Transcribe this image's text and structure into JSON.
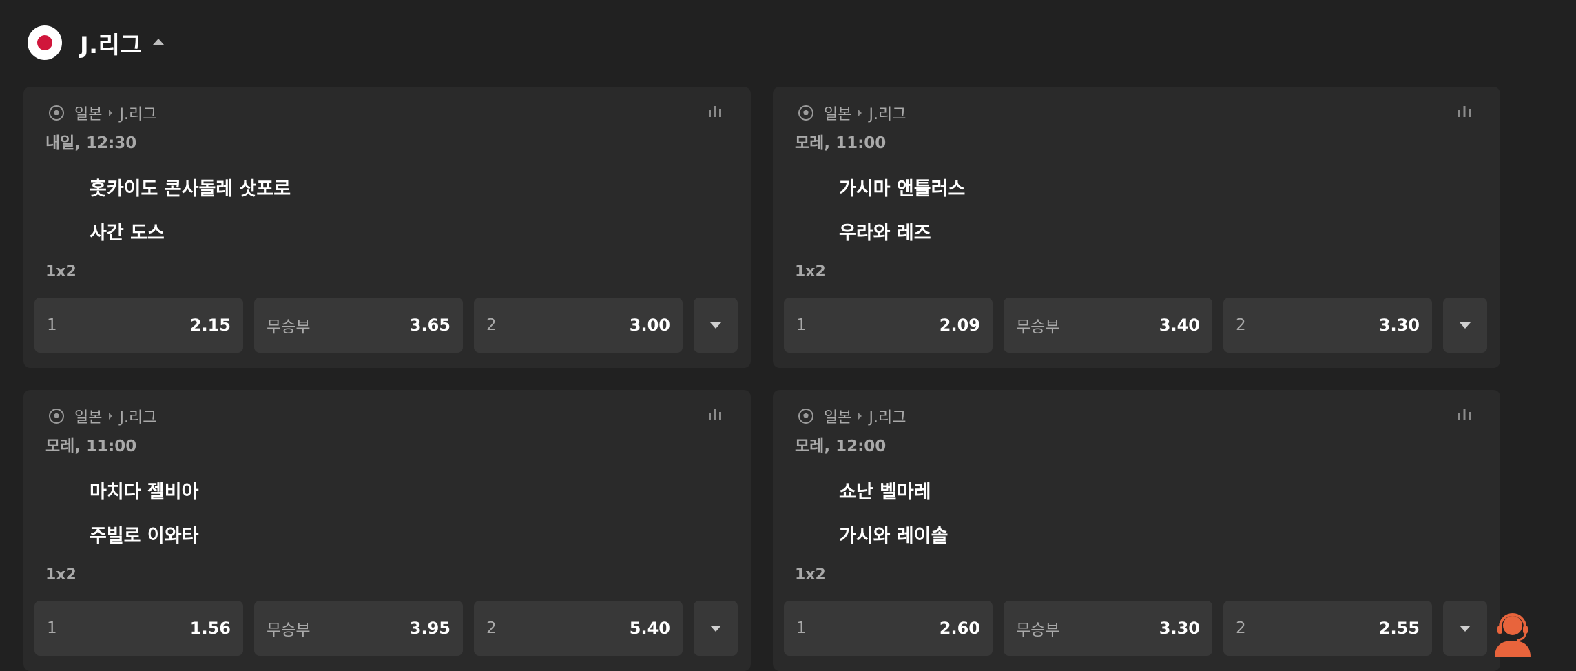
{
  "league": {
    "title": "J.리그"
  },
  "matches": [
    {
      "country": "일본",
      "league": "J.리그",
      "time": "내일, 12:30",
      "home": "홋카이도 콘사돌레 삿포로",
      "away": "사간 도스",
      "market": "1x2",
      "odds": [
        {
          "label": "1",
          "value": "2.15"
        },
        {
          "label": "무승부",
          "value": "3.65"
        },
        {
          "label": "2",
          "value": "3.00"
        }
      ]
    },
    {
      "country": "일본",
      "league": "J.리그",
      "time": "모레, 11:00",
      "home": "가시마 앤틀러스",
      "away": "우라와 레즈",
      "market": "1x2",
      "odds": [
        {
          "label": "1",
          "value": "2.09"
        },
        {
          "label": "무승부",
          "value": "3.40"
        },
        {
          "label": "2",
          "value": "3.30"
        }
      ]
    },
    {
      "country": "일본",
      "league": "J.리그",
      "time": "모레, 11:00",
      "home": "마치다 젤비아",
      "away": "주빌로 이와타",
      "market": "1x2",
      "odds": [
        {
          "label": "1",
          "value": "1.56"
        },
        {
          "label": "무승부",
          "value": "3.95"
        },
        {
          "label": "2",
          "value": "5.40"
        }
      ]
    },
    {
      "country": "일본",
      "league": "J.리그",
      "time": "모레, 12:00",
      "home": "쇼난 벨마레",
      "away": "가시와 레이솔",
      "market": "1x2",
      "odds": [
        {
          "label": "1",
          "value": "2.60"
        },
        {
          "label": "무승부",
          "value": "3.30"
        },
        {
          "label": "2",
          "value": "2.55"
        }
      ]
    }
  ],
  "icons": {
    "ball": "soccer-ball-icon",
    "stats": "stats-bar-icon",
    "expand": "chevron-down-icon",
    "support": "support-agent-icon"
  },
  "colors": {
    "background": "#212121",
    "card": "#2a2a2a",
    "odd_button": "#383838",
    "flag_red": "#d0163b",
    "support_accent": "#e8643c"
  }
}
